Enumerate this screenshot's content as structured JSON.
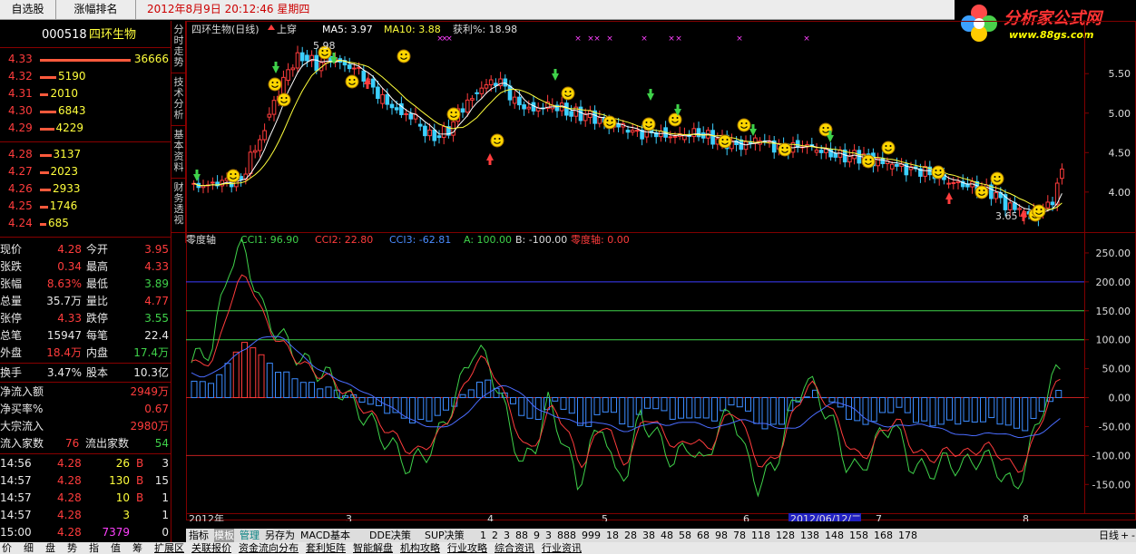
{
  "topbar": {
    "tab1": "自选股",
    "tab2": "涨幅排名",
    "datetime": "2012年8月9日  20:12:46 星期四"
  },
  "logo": {
    "title": "分析家公式网",
    "url": "www.88gs.com"
  },
  "stock": {
    "code": "000518",
    "name": "四环生物"
  },
  "asks": [
    {
      "price": "4.33",
      "vol": "36666"
    },
    {
      "price": "4.32",
      "vol": "5190"
    },
    {
      "price": "4.31",
      "vol": "2010"
    },
    {
      "price": "4.30",
      "vol": "6843"
    },
    {
      "price": "4.29",
      "vol": "4229"
    }
  ],
  "bids": [
    {
      "price": "4.28",
      "vol": "3137"
    },
    {
      "price": "4.27",
      "vol": "2023"
    },
    {
      "price": "4.26",
      "vol": "2933"
    },
    {
      "price": "4.25",
      "vol": "1746"
    },
    {
      "price": "4.24",
      "vol": "685"
    }
  ],
  "quote": [
    {
      "l1": "现价",
      "v1": "4.28",
      "l2": "今开",
      "v2": "3.95"
    },
    {
      "l1": "张跌",
      "v1": "0.34",
      "l2": "最高",
      "v2": "4.33"
    },
    {
      "l1": "张幅",
      "v1": "8.63%",
      "l2": "最低",
      "v2": "3.89"
    },
    {
      "l1": "总量",
      "v1": "35.7万",
      "l2": "量比",
      "v2": "4.77"
    },
    {
      "l1": "张停",
      "v1": "4.33",
      "l2": "跌停",
      "v2": "3.55"
    },
    {
      "l1": "总笔",
      "v1": "15947",
      "l2": "每笔",
      "v2": "22.4"
    },
    {
      "l1": "外盘",
      "v1": "18.4万",
      "l2": "内盘",
      "v2": "17.4万"
    }
  ],
  "turnover": {
    "l1": "换手",
    "v1": "3.47%",
    "l2": "股本",
    "v2": "10.3亿"
  },
  "flows": [
    {
      "label": "净流入额",
      "value": "2949万"
    },
    {
      "label": "净买率%",
      "value": "0.67"
    },
    {
      "label": "大宗流入",
      "value": "2980万"
    }
  ],
  "inout": {
    "l1": "流入家数",
    "v1": "76",
    "l2": "流出家数",
    "v2": "54"
  },
  "ticks": [
    {
      "t": "14:56",
      "p": "4.28",
      "v": "26",
      "bs": "B",
      "n": "3"
    },
    {
      "t": "14:57",
      "p": "4.28",
      "v": "130",
      "bs": "B",
      "n": "15"
    },
    {
      "t": "14:57",
      "p": "4.28",
      "v": "10",
      "bs": "B",
      "n": "1"
    },
    {
      "t": "14:57",
      "p": "4.28",
      "v": "3",
      "bs": "",
      "n": "1"
    },
    {
      "t": "15:00",
      "p": "4.28",
      "v": "7379",
      "bs": "",
      "n": "0"
    }
  ],
  "sidetabs": [
    "分时走势",
    "技术分析",
    "基本资料",
    "财务透视"
  ],
  "main": {
    "title": "四环生物(日线)",
    "signal": "上穿",
    "ma5": "MA5: 3.97",
    "ma10": "MA10: 3.88",
    "profit": "获利%: 18.98",
    "high_label": "5.98",
    "low_label": "3.65",
    "yticks": [
      "5.50",
      "5.00",
      "4.50",
      "4.00"
    ]
  },
  "sub": {
    "title": "零度轴",
    "cci1": "CCI1: 96.90",
    "cci2": "CCI2: 22.80",
    "cci3": "CCI3: -62.81",
    "a": "A: 100.00",
    "b": "B: -100.00",
    "zero": "零度轴: 0.00",
    "yticks": [
      "250.00",
      "200.00",
      "150.00",
      "100.00",
      "50.00",
      "0.00",
      "-50.00",
      "-100.00",
      "-150.00"
    ]
  },
  "xaxis": {
    "labels": [
      "2012年",
      "3",
      "4",
      "5",
      "6",
      "7",
      "8"
    ],
    "cursor": "2012/06/12/二"
  },
  "bottom_tabs": [
    "指标",
    "模板",
    "管理",
    "另存为",
    "MACD基本",
    "DDE决策",
    "SUP决策",
    "1",
    "2",
    "3",
    "88",
    "9",
    "3",
    "888",
    "999",
    "18",
    "28",
    "38",
    "48",
    "58",
    "68",
    "98",
    "78",
    "118",
    "128",
    "138",
    "148",
    "158",
    "168",
    "178"
  ],
  "period": "日线",
  "bottom_links": [
    "价",
    "细",
    "盘",
    "势",
    "指",
    "值",
    "筹",
    "扩展区",
    "关联报价",
    "资金流向分布",
    "套利矩阵",
    "智能解盘",
    "机构攻略",
    "行业攻略",
    "综合资讯",
    "行业资讯"
  ],
  "colors": {
    "up": "#ff3c3c",
    "down": "#3cd0ff",
    "cci1": "#3fd24a",
    "cci2": "#ff3c3c",
    "cci3": "#4a6cff",
    "frame": "#800000"
  }
}
